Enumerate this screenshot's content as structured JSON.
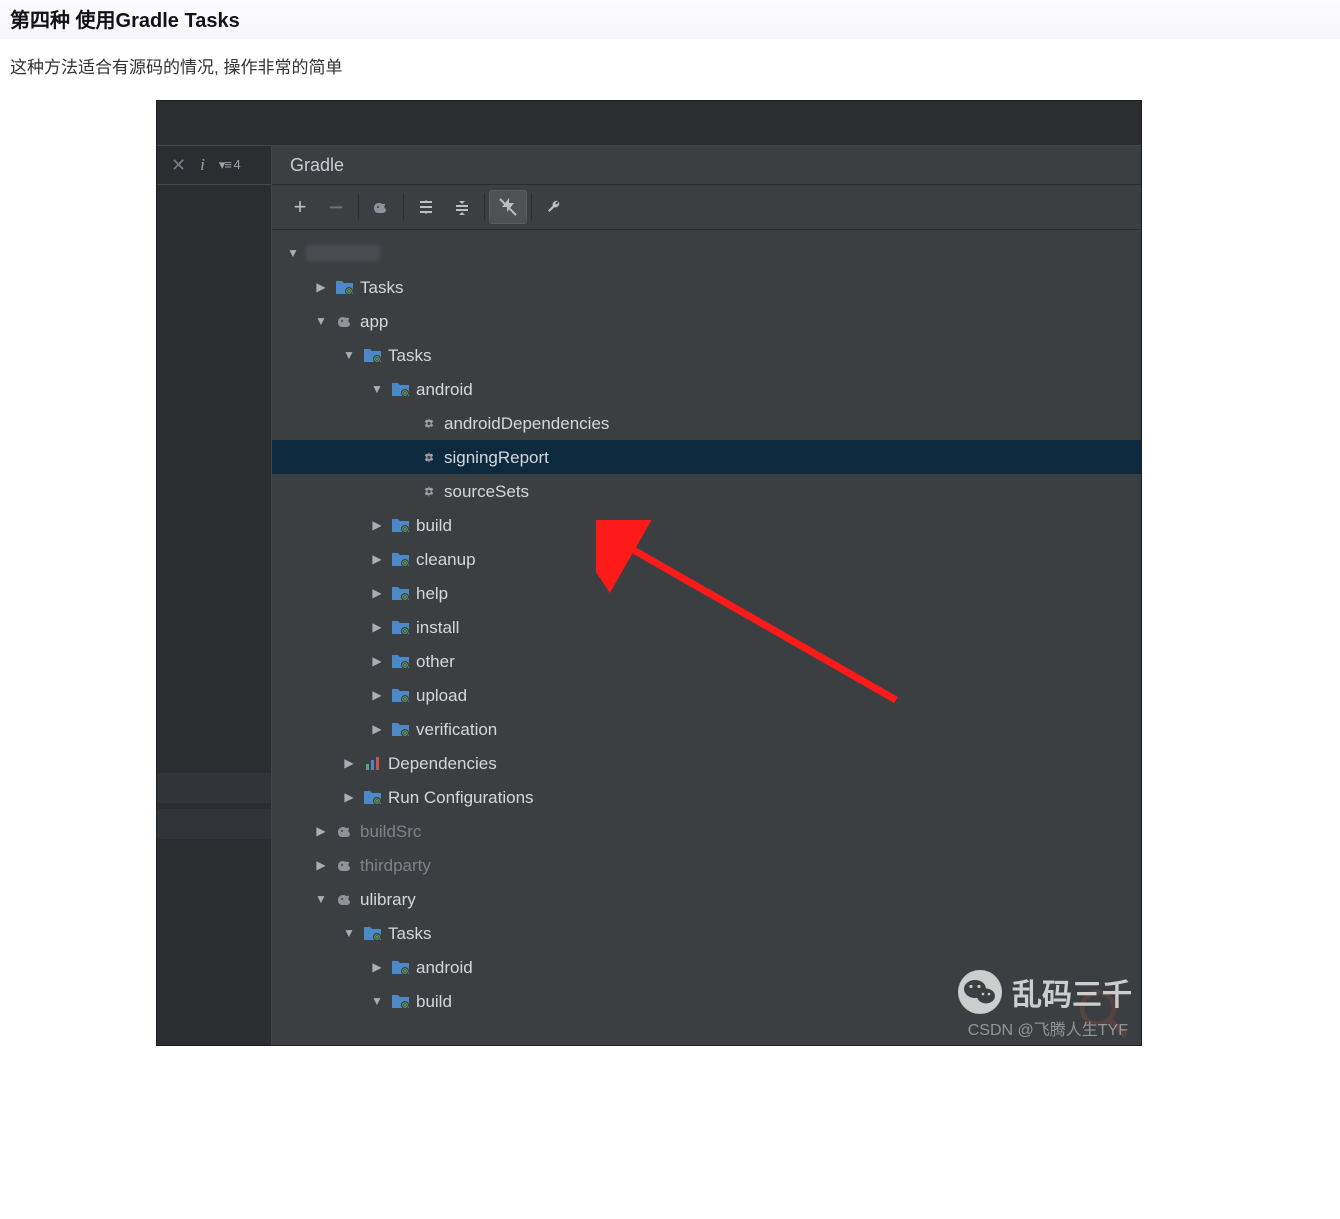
{
  "heading": "第四种  使用Gradle Tasks",
  "intro": "这种方法适合有源码的情况, 操作非常的简单",
  "gutter": {
    "list_indicator": "≡ 4"
  },
  "panel": {
    "title": "Gradle",
    "toolbar": {
      "add": "+",
      "remove": "−"
    }
  },
  "tree": {
    "rootRedacted": "(project name)",
    "tasks": "Tasks",
    "app": "app",
    "app_tasks": "Tasks",
    "android": "android",
    "androidDependencies": "androidDependencies",
    "signingReport": "signingReport",
    "sourceSets": "sourceSets",
    "build": "build",
    "cleanup": "cleanup",
    "help": "help",
    "install": "install",
    "other": "other",
    "upload": "upload",
    "verification": "verification",
    "dependencies": "Dependencies",
    "runConfigurations": "Run Configurations",
    "buildSrc": "buildSrc",
    "thirdparty": "thirdparty",
    "ulibrary": "ulibrary",
    "u_tasks": "Tasks",
    "u_android": "android",
    "u_build": "build"
  },
  "watermark": {
    "wechat": "乱码三千",
    "csdn": "CSDN @飞腾人生TYF"
  }
}
